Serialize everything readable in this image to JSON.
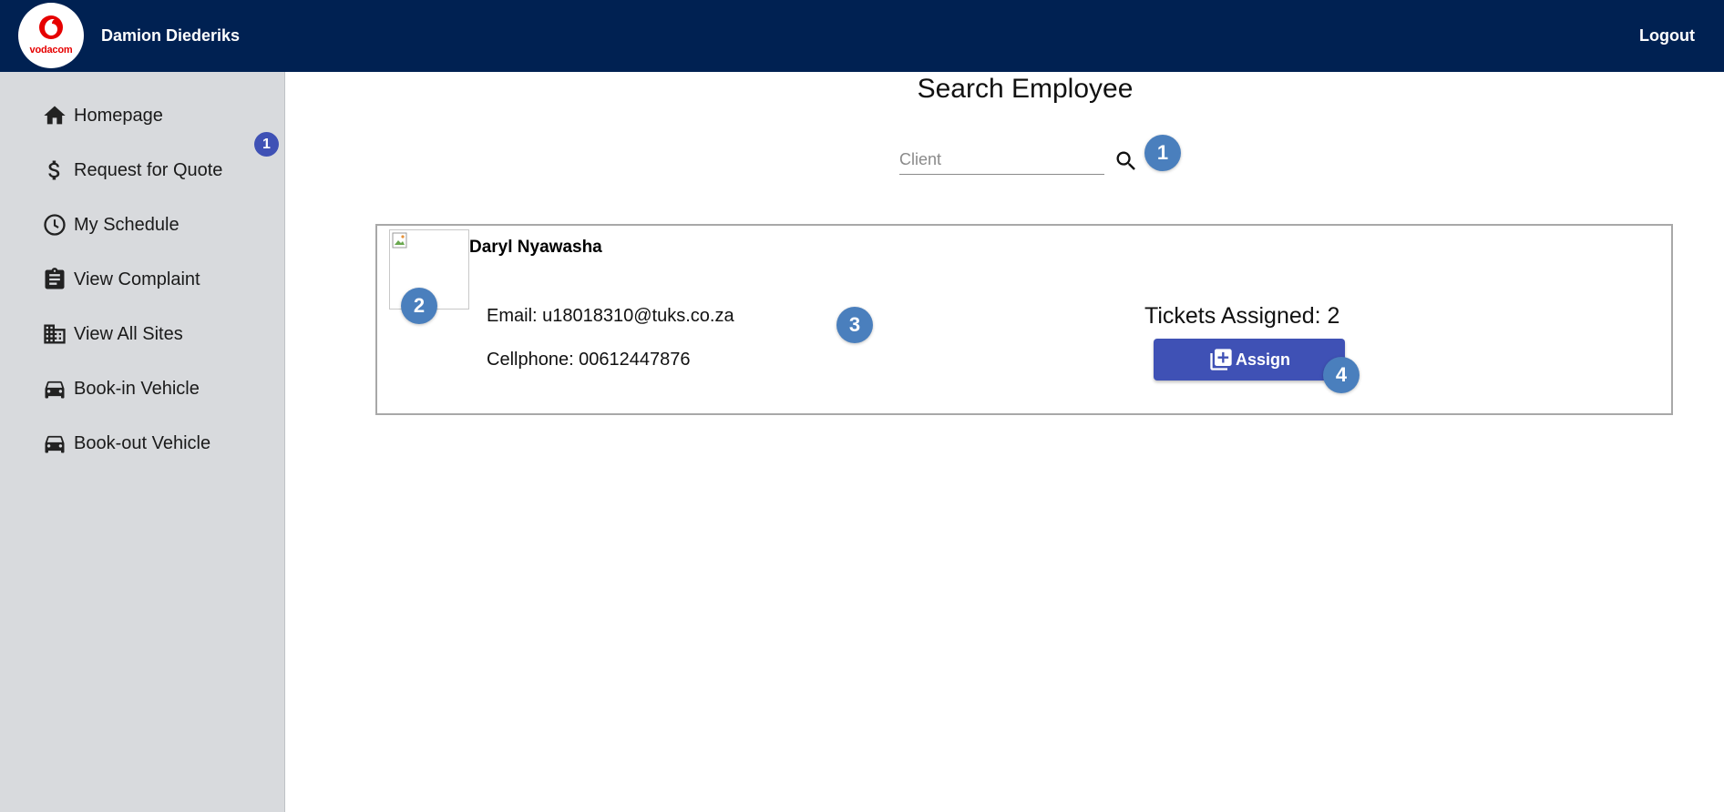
{
  "header": {
    "logo_text": "vodacom",
    "user_name": "Damion Diederiks",
    "logout_label": "Logout",
    "background_color": "#002152"
  },
  "sidebar": {
    "badge": "1",
    "items": [
      {
        "label": "Homepage",
        "icon": "home-icon"
      },
      {
        "label": "Request for Quote",
        "icon": "dollar-icon"
      },
      {
        "label": "My Schedule",
        "icon": "clock-icon"
      },
      {
        "label": "View Complaint",
        "icon": "clipboard-icon"
      },
      {
        "label": "View All Sites",
        "icon": "building-icon"
      },
      {
        "label": "Book-in Vehicle",
        "icon": "car-icon"
      },
      {
        "label": "Book-out Vehicle",
        "icon": "car-icon"
      }
    ]
  },
  "main": {
    "title": "Search Employee",
    "search": {
      "placeholder": "Client",
      "value": ""
    },
    "employee": {
      "name": "Daryl Nyawasha",
      "email": "Email: u18018310@tuks.co.za",
      "cellphone": "Cellphone: 00612447876",
      "tickets": "Tickets Assigned: 2",
      "assign_label": "Assign"
    }
  },
  "markers": [
    "1",
    "2",
    "3",
    "4"
  ],
  "colors": {
    "accent": "#3f51b5",
    "marker": "#4a7fbd",
    "brand_red": "#e60000"
  }
}
